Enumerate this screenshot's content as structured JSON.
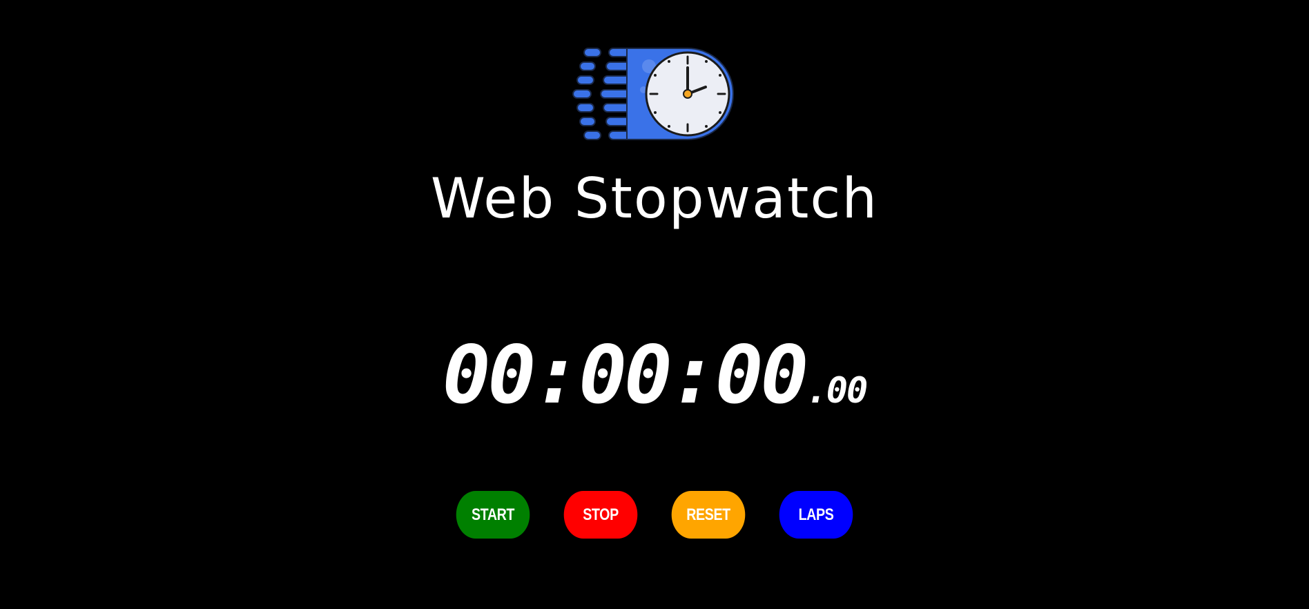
{
  "app": {
    "title": "Web Stopwatch",
    "logo_icon": "stopwatch-clock-icon",
    "logo_color": "#3a72e8"
  },
  "timer": {
    "main": "00:00:00",
    "fraction": ".00"
  },
  "controls": [
    {
      "label": "START",
      "color": "#008000"
    },
    {
      "label": "STOP",
      "color": "#ff0000"
    },
    {
      "label": "RESET",
      "color": "#ffa500"
    },
    {
      "label": "LAPS",
      "color": "#0000ff"
    }
  ]
}
